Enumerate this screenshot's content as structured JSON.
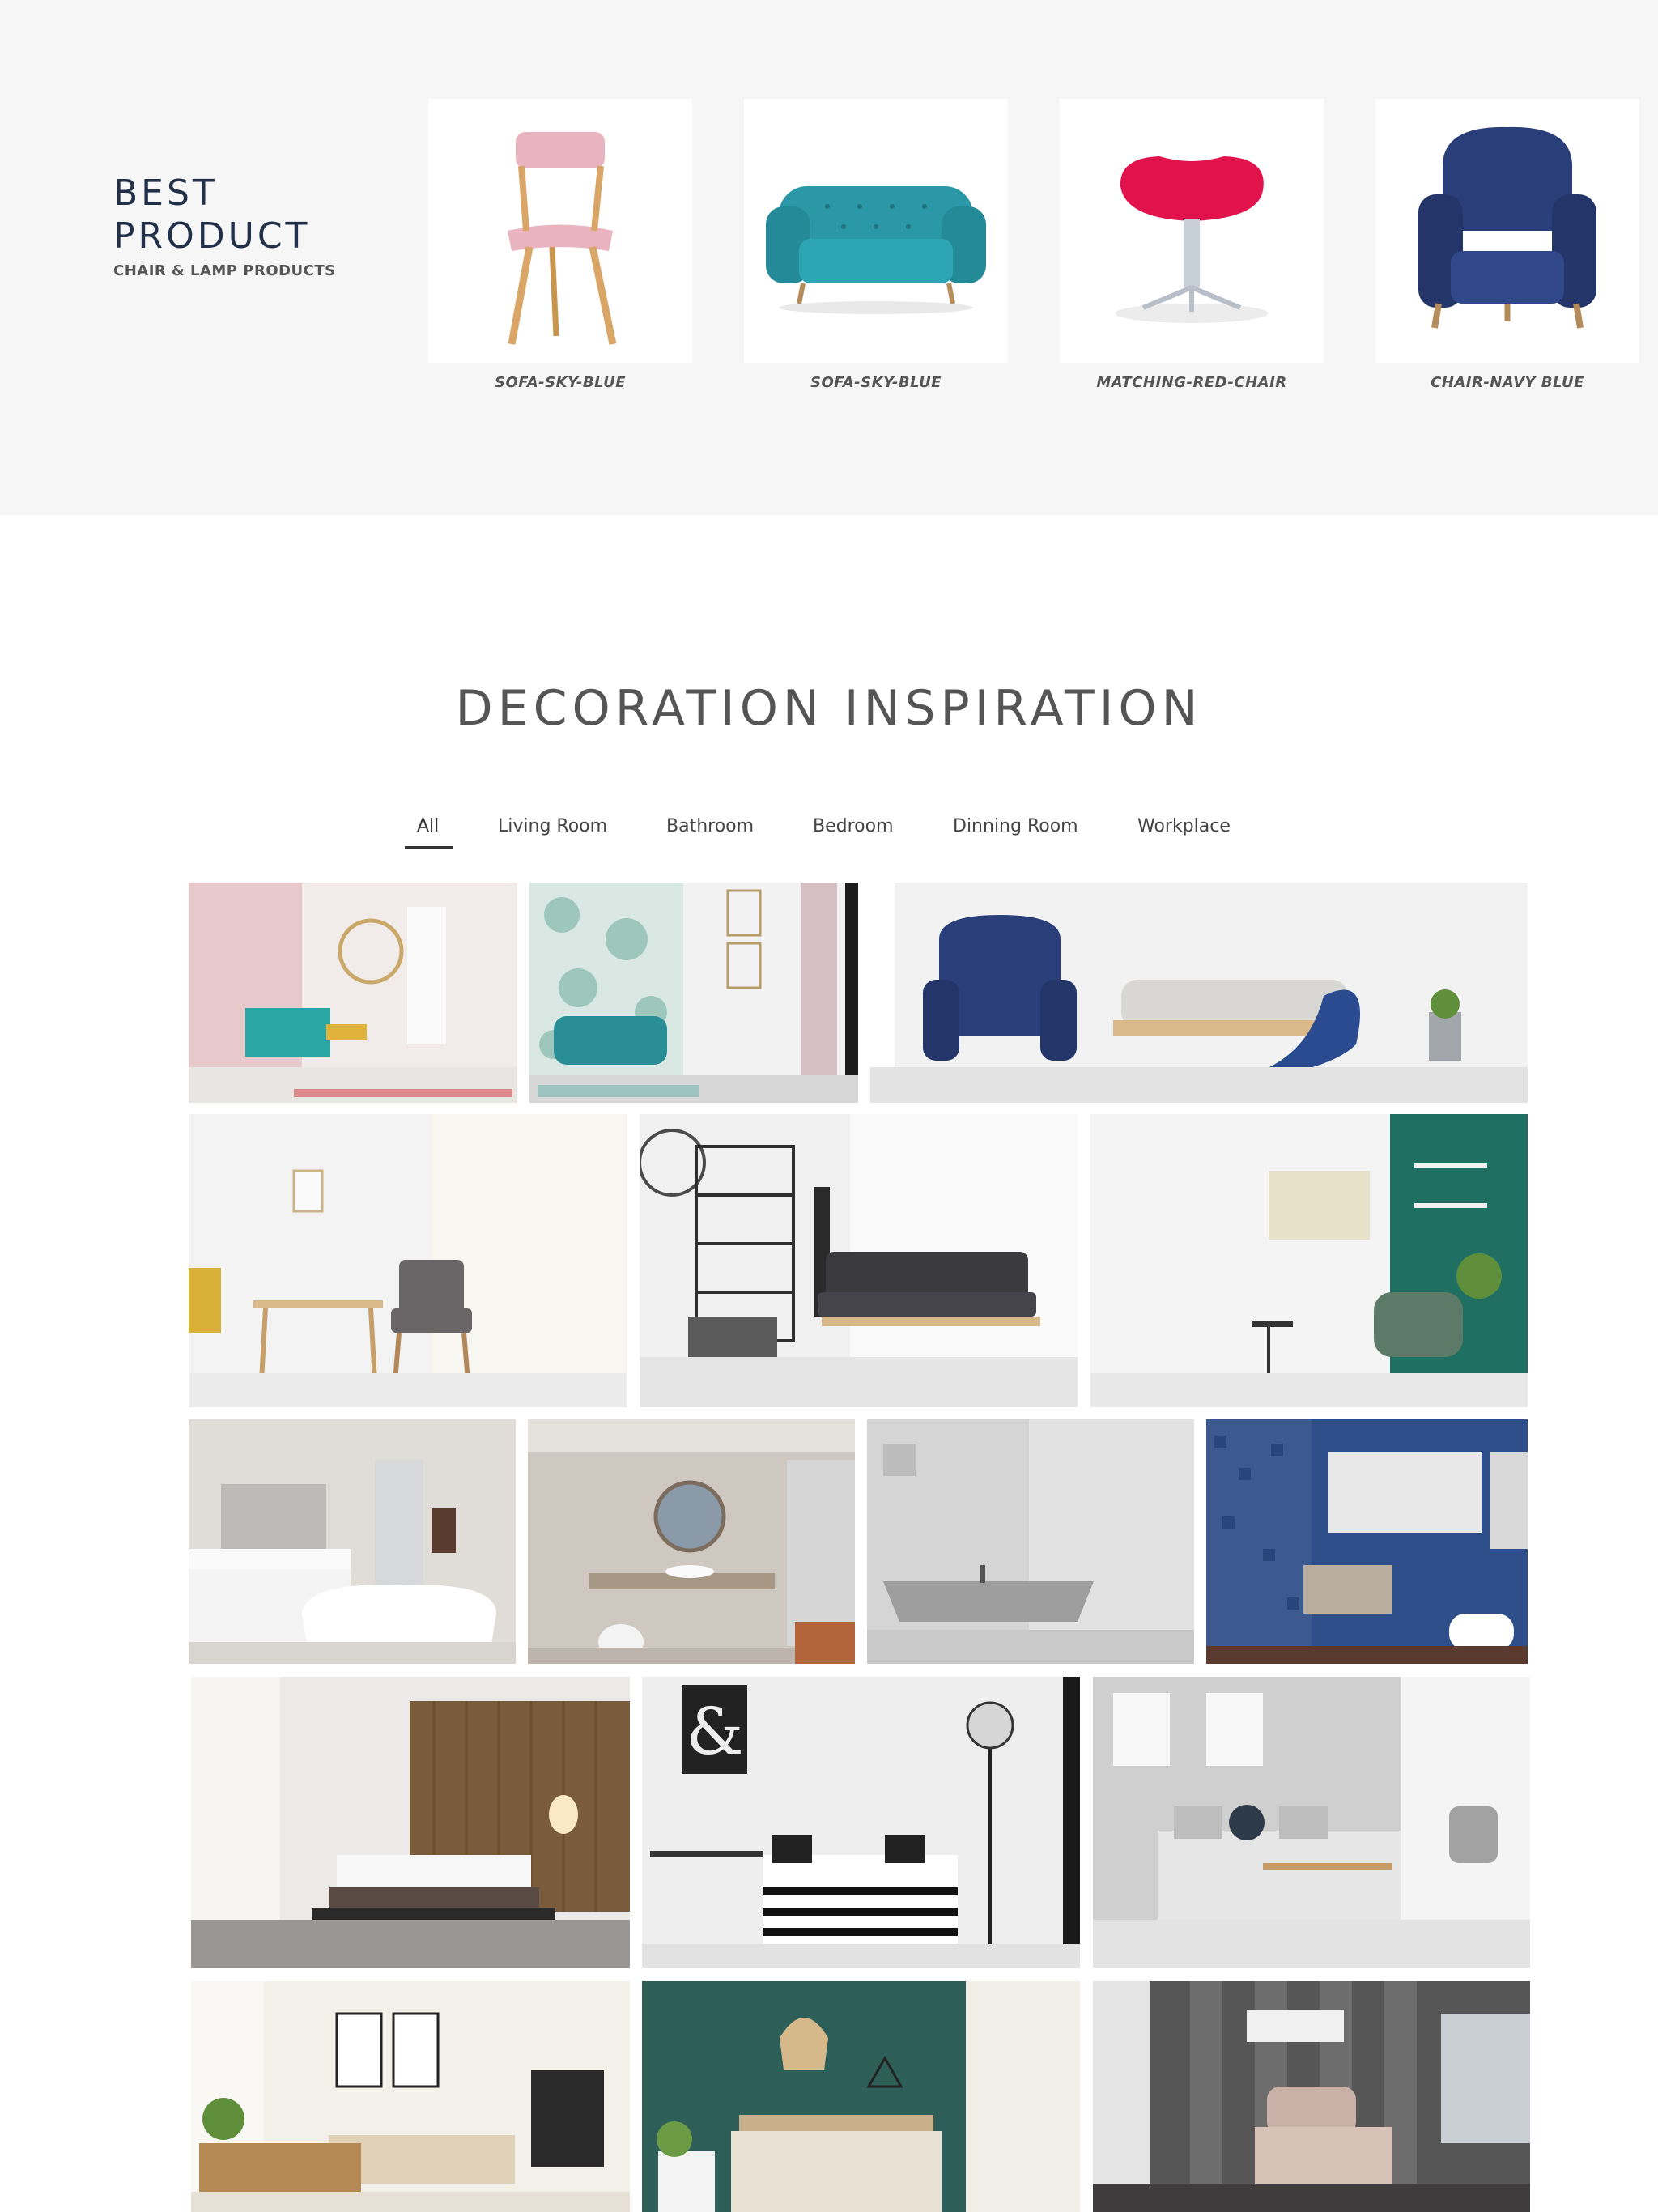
{
  "best_product": {
    "title": "BEST\nPRODUCT",
    "subtitle": "CHAIR & LAMP PRODUCTS",
    "products": [
      {
        "name": "SOFA-SKY-BLUE",
        "color": "#e9b3c0",
        "icon": "pink-chair-icon"
      },
      {
        "name": "SOFA-SKY-BLUE",
        "color": "#2a98a6",
        "icon": "teal-sofa-icon"
      },
      {
        "name": "MATCHING-RED-CHAIR",
        "color": "#e2124c",
        "icon": "red-stool-icon"
      },
      {
        "name": "CHAIR-NAVY BLUE",
        "color": "#2a3f7a",
        "icon": "navy-armchair-icon"
      }
    ]
  },
  "inspiration": {
    "title": "DECORATION INSPIRATION",
    "tabs": [
      "All",
      "Living Room",
      "Bathroom",
      "Bedroom",
      "Dinning Room",
      "Workplace"
    ],
    "active_tab": "All",
    "photos": [
      {
        "name": "pastel-living-room-photo",
        "wall": "#f1ecea",
        "accent": "#2aa7a5",
        "floor": "#e8e5e2"
      },
      {
        "name": "palm-wallpaper-sofa-photo",
        "wall": "#d9e8e3",
        "accent": "#2a8e96",
        "floor": "#d7d7d7"
      },
      {
        "name": "navy-armchair-swing-photo",
        "wall": "#f2f2f2",
        "accent": "#2a3f7a",
        "floor": "#e3e3e3"
      },
      {
        "name": "yellow-gray-chairs-photo",
        "wall": "#f3f3f3",
        "accent": "#d9b03a",
        "floor": "#ebebeb"
      },
      {
        "name": "black-futon-shelf-photo",
        "wall": "#f0f0f0",
        "accent": "#3b3b3f",
        "floor": "#e5e5e5"
      },
      {
        "name": "green-wall-armchair-photo",
        "wall": "#f4f4f4",
        "accent": "#1f6f63",
        "floor": "#e8e8e8"
      },
      {
        "name": "white-bath-mirror-photo",
        "wall": "#e6e3e0",
        "accent": "#ffffff",
        "floor": "#d8d4d0"
      },
      {
        "name": "round-mirror-bathroom-photo",
        "wall": "#cfc8c1",
        "accent": "#a79886",
        "floor": "#bdb5ad"
      },
      {
        "name": "gray-sink-bathroom-photo",
        "wall": "#d5d5d5",
        "accent": "#9e9e9e",
        "floor": "#c9c9c9"
      },
      {
        "name": "blue-tile-bathroom-photo",
        "wall": "#2f4f8a",
        "accent": "#b9aea0",
        "floor": "#3c5a8f"
      },
      {
        "name": "wood-wall-bedroom-photo",
        "wall": "#eceae8",
        "accent": "#7a5b3c",
        "floor": "#9a9694"
      },
      {
        "name": "ampersand-bedroom-photo",
        "wall": "#eeeeee",
        "accent": "#222222",
        "floor": "#e2e2e2"
      },
      {
        "name": "gray-knot-bedroom-photo",
        "wall": "#cfcfcf",
        "accent": "#8c8c8c",
        "floor": "#e3e3e3"
      },
      {
        "name": "rattan-bedroom-photo",
        "wall": "#f3efe9",
        "accent": "#b58a55",
        "floor": "#e7e0d6"
      },
      {
        "name": "green-pendant-bedroom-photo",
        "wall": "#2d5f58",
        "accent": "#d9c9a8",
        "floor": "#e6e2dc"
      },
      {
        "name": "striped-wall-bedroom-photo",
        "wall": "#565656",
        "accent": "#c9b1a8",
        "floor": "#3f3c3d"
      }
    ]
  }
}
